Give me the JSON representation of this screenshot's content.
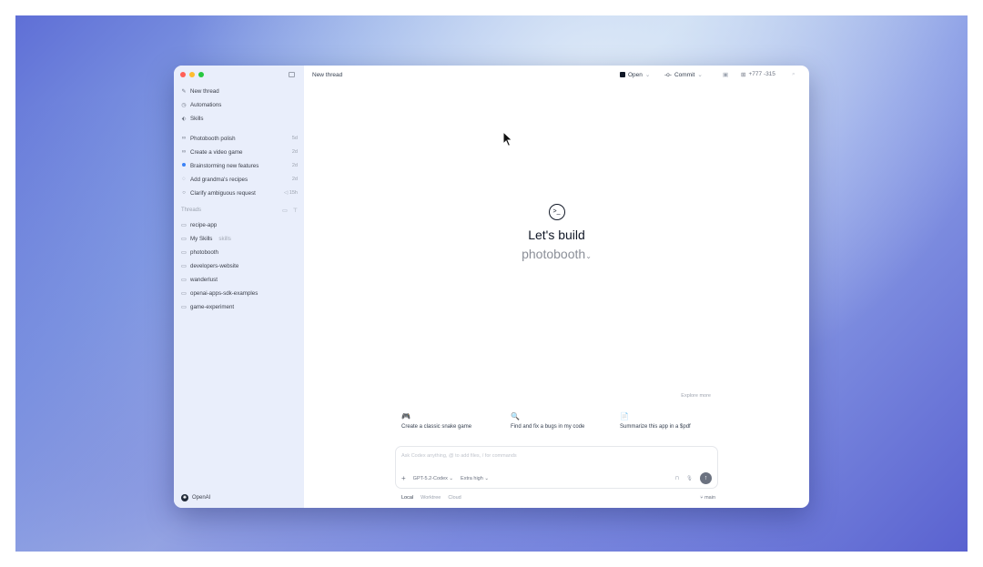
{
  "window": {
    "title": "New thread"
  },
  "sidebar": {
    "top_items": [
      {
        "label": "New thread",
        "icon": "edit-icon"
      },
      {
        "label": "Automations",
        "icon": "clock-icon"
      },
      {
        "label": "Skills",
        "icon": "tag-icon"
      }
    ],
    "recent": [
      {
        "label": "Photobooth polish",
        "meta": "5d"
      },
      {
        "label": "Create a video game",
        "meta": "2d"
      },
      {
        "label": "Brainstorming new features",
        "meta": "2d"
      },
      {
        "label": "Add grandma's recipes",
        "meta": "2d"
      },
      {
        "label": "Clarify ambiguous request",
        "meta": "15h"
      }
    ],
    "threads_heading": "Threads",
    "threads": [
      {
        "label": "recipe-app",
        "sub": ""
      },
      {
        "label": "My Skills",
        "sub": "skills"
      },
      {
        "label": "photobooth",
        "sub": ""
      },
      {
        "label": "developers-website",
        "sub": ""
      },
      {
        "label": "wanderlust",
        "sub": ""
      },
      {
        "label": "openai-apps-sdk-examples",
        "sub": ""
      },
      {
        "label": "game-experiment",
        "sub": ""
      }
    ],
    "footer": "OpenAI"
  },
  "toolbar": {
    "open_label": "Open",
    "commit_label": "Commit",
    "diff_label": "+777 -315"
  },
  "hero": {
    "title": "Let's build",
    "project": "photobooth"
  },
  "explore": "Explore more",
  "suggestions": [
    {
      "label": "Create a classic snake game",
      "icon": "gamepad-icon"
    },
    {
      "label": "Find and fix a bugs in my code",
      "icon": "search-icon"
    },
    {
      "label": "Summarize this app in a $pdf",
      "icon": "document-icon"
    }
  ],
  "composer": {
    "placeholder": "Ask Codex anything, @ to add files, / for commands",
    "model": "GPT-5.2-Codex",
    "reasoning": "Extra high"
  },
  "bottombar": {
    "tabs": [
      "Local",
      "Worktree",
      "Cloud"
    ],
    "branch": "main"
  }
}
